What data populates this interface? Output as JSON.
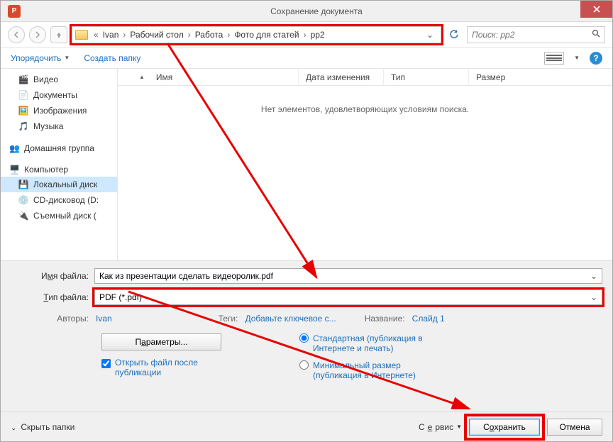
{
  "window": {
    "title": "Сохранение документа"
  },
  "breadcrumb": {
    "prefix": "«",
    "items": [
      "Ivan",
      "Рабочий стол",
      "Работа",
      "Фото для статей",
      "pp2"
    ]
  },
  "search": {
    "placeholder": "Поиск: pp2"
  },
  "toolbar": {
    "organize": "Упорядочить",
    "new_folder": "Создать папку"
  },
  "sidebar": {
    "videos": "Видео",
    "documents": "Документы",
    "pictures": "Изображения",
    "music": "Музыка",
    "homegroup": "Домашняя группа",
    "computer": "Компьютер",
    "local_disk": "Локальный диск",
    "cd_drive": "CD-дисковод (D:",
    "removable": "Съемный диск ("
  },
  "columns": {
    "name": "Имя",
    "date": "Дата изменения",
    "type": "Тип",
    "size": "Размер"
  },
  "filepane": {
    "empty": "Нет элементов, удовлетворяющих условиям поиска."
  },
  "fields": {
    "filename_label_pre": "И",
    "filename_label_u": "м",
    "filename_label_post": "я файла:",
    "filename_value": "Как из презентации сделать видеоролик.pdf",
    "filetype_label_pre": "",
    "filetype_label_u": "Т",
    "filetype_label_post": "ип файла:",
    "filetype_value": "PDF (*.pdf)"
  },
  "meta": {
    "authors_label": "Авторы:",
    "authors_value": "Ivan",
    "tags_label": "Теги:",
    "tags_value": "Добавьте ключевое с...",
    "title_label": "Название:",
    "title_value": "Слайд 1"
  },
  "options": {
    "params_pre": "П",
    "params_u": "а",
    "params_post": "раметры...",
    "open_after": "Открыть файл после публикации",
    "radio_standard": "Стандартная (публикация в Интернете и печать)",
    "radio_minimum": "Минимальный размер (публикация в Интернете)"
  },
  "footer": {
    "hide_folders": "Скрыть папки",
    "tools_pre": "С",
    "tools_u": "е",
    "tools_post": "рвис",
    "save_pre": "С",
    "save_u": "о",
    "save_post": "хранить",
    "cancel": "Отмена"
  }
}
